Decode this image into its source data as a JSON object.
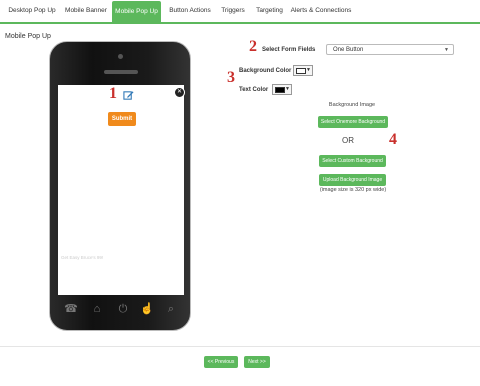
{
  "tabs": [
    "Desktop Pop Up",
    "Mobile Banner",
    "Mobile Pop Up",
    "Button Actions",
    "Triggers",
    "Targeting",
    "Alerts & Connections"
  ],
  "section_title": "Mobile Pop Up",
  "phone": {
    "submit_label": "Submit",
    "footer_text": "Get Easy Bruce's 99!"
  },
  "markers": [
    "1",
    "2",
    "3",
    "4"
  ],
  "form": {
    "fields_label": "Select Form Fields",
    "fields_value": "One Button",
    "bg_color_label": "Background Color",
    "text_color_label": "Text Color",
    "bg_color": "#ffffff",
    "text_color": "#000000"
  },
  "background": {
    "title": "Background Image",
    "select_onemore": "Select Onemore Background",
    "or": "OR",
    "select_custom": "Select Custom Background",
    "upload": "Upload Background Image",
    "size_note": "(image size is 320 px wide)"
  },
  "nav": {
    "previous": "<< Previous",
    "next": "Next >>"
  }
}
